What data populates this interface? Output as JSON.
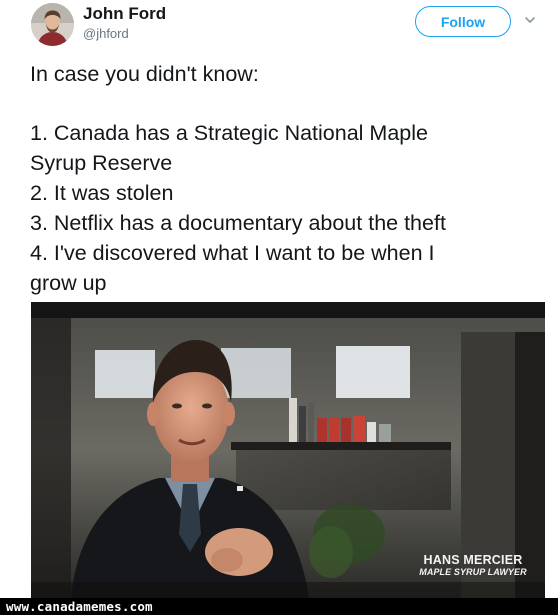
{
  "tweet": {
    "author": {
      "name": "John Ford",
      "handle": "@jhford"
    },
    "follow_label": "Follow",
    "intro": "In case you didn't know:",
    "items": [
      "1. Canada has a Strategic National Maple",
      "Syrup Reserve",
      "2. It was stolen",
      "3. Netflix has a documentary about the theft",
      "4. I've discovered what I want to be when I",
      "grow up"
    ]
  },
  "photo": {
    "caption_name": "HANS MERCIER",
    "caption_role": "MAPLE SYRUP LAWYER"
  },
  "watermark": {
    "text": "www.canadamemes.com"
  },
  "colors": {
    "accent": "#1da1f2",
    "text": "#14171a",
    "secondary_text": "#657786"
  },
  "icons": [
    "avatar",
    "chevron-down-icon"
  ]
}
